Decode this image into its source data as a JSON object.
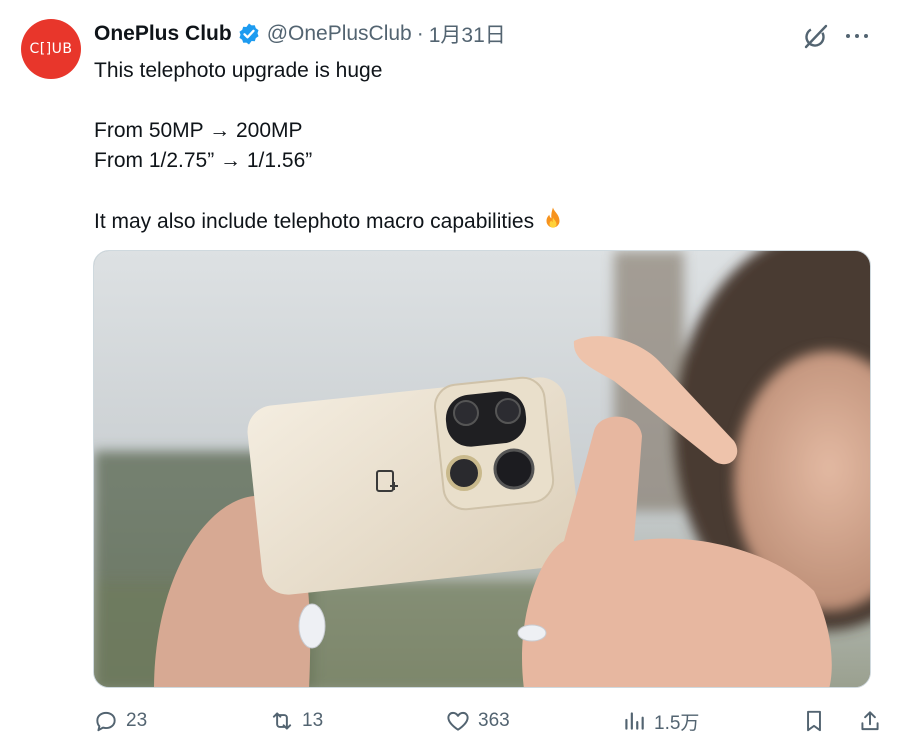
{
  "user": {
    "avatar_text": "C[]UB",
    "display_name": "OnePlus Club",
    "handle": "@OnePlusClub",
    "separator": "·",
    "date": "1月31日",
    "verified": true
  },
  "tweet": {
    "lines": [
      "This telephoto upgrade is huge",
      "",
      "From 50MP → 200MP",
      "From 1/2.75” → 1/1.56”",
      "",
      "It may also include telephoto macro capabilities"
    ],
    "emoji": "fire-icon"
  },
  "actions": {
    "replies": "23",
    "retweets": "13",
    "likes": "363",
    "views": "1.5万"
  },
  "colors": {
    "brand_red": "#e8362b",
    "verified_blue": "#1d9bf0",
    "muted_text": "#536471",
    "phone_cream": "#ece3d2"
  }
}
